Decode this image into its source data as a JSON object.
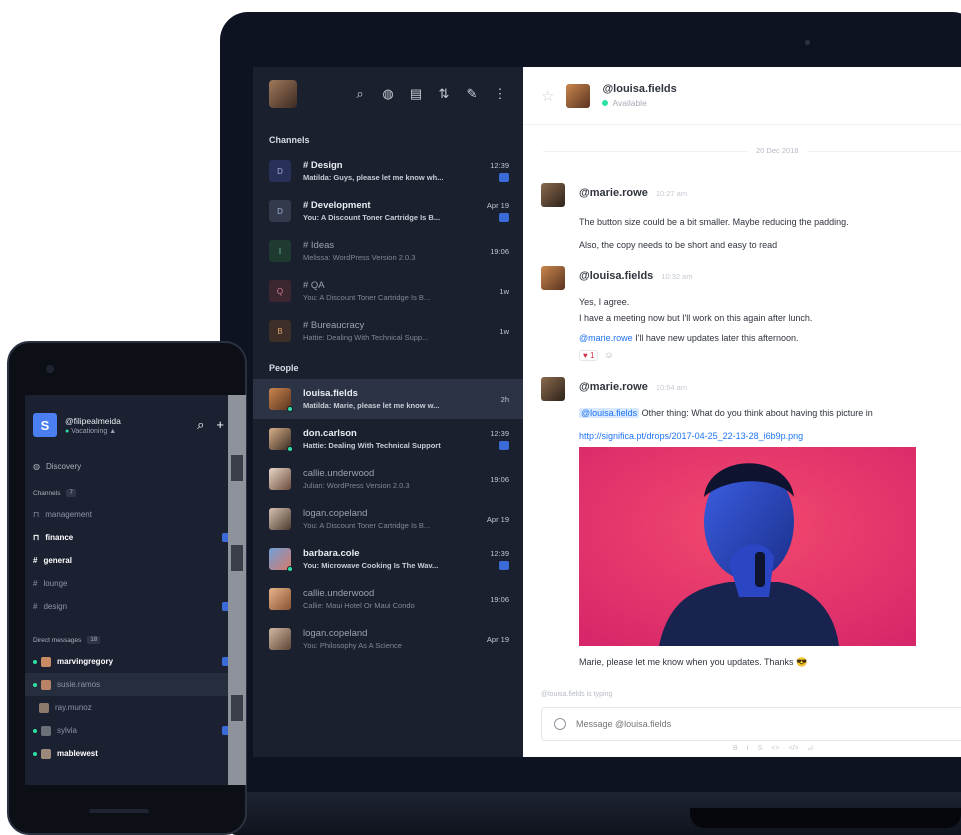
{
  "desktop": {
    "sidebar": {
      "channels_title": "Channels",
      "people_title": "People",
      "toolbar_icons": [
        "search-icon",
        "globe-icon",
        "directory-icon",
        "sort-icon",
        "edit-icon",
        "more-icon"
      ],
      "channels": [
        {
          "avatar": "D",
          "name": "# Design",
          "message": "Matilda: Guys, please let me know wh...",
          "time": "12:39",
          "unread": true,
          "bold": true
        },
        {
          "avatar": "D",
          "name": "# Development",
          "message": "You: A Discount Toner Cartridge Is B...",
          "time": "Apr 19",
          "unread": true,
          "bold": true
        },
        {
          "avatar": "I",
          "name": "# Ideas",
          "message": "Melissa: WordPress Version 2.0.3",
          "time": "19:06",
          "unread": false,
          "bold": false
        },
        {
          "avatar": "Q",
          "name": "# QA",
          "message": "You: A Discount Toner Cartridge Is B...",
          "time": "1w",
          "unread": false,
          "bold": false
        },
        {
          "avatar": "B",
          "name": "# Bureaucracy",
          "message": "Hattie: Dealing With Technical Supp...",
          "time": "1w",
          "unread": false,
          "bold": false
        }
      ],
      "people": [
        {
          "name": "louisa.fields",
          "message": "Matilda: Marie, please let me know w...",
          "time": "2h",
          "unread": false,
          "bold": true,
          "active": true
        },
        {
          "name": "don.carlson",
          "message": "Hattie: Dealing With Technical Support",
          "time": "12:39",
          "unread": true,
          "bold": true,
          "active": false
        },
        {
          "name": "callie.underwood",
          "message": "Julian: WordPress Version 2.0.3",
          "time": "19:06",
          "unread": false,
          "bold": false,
          "active": false
        },
        {
          "name": "logan.copeland",
          "message": "You: A Discount Toner Cartridge Is B...",
          "time": "Apr 19",
          "unread": false,
          "bold": false,
          "active": false
        },
        {
          "name": "barbara.cole",
          "message": "You: Microwave Cooking Is The Wav...",
          "time": "12:39",
          "unread": true,
          "bold": true,
          "active": false
        },
        {
          "name": "callie.underwood",
          "message": "Callie: Maui Hotel Or Maui Condo",
          "time": "19:06",
          "unread": false,
          "bold": false,
          "active": false
        },
        {
          "name": "logan.copeland",
          "message": "You: Philosophy As A Science",
          "time": "Apr 19",
          "unread": false,
          "bold": false,
          "active": false
        }
      ]
    },
    "chat": {
      "header_name": "@louisa.fields",
      "header_status": "Available",
      "date_separator": "20 Dec 2018",
      "messages": [
        {
          "user": "@marie.rowe",
          "time": "10:27 am",
          "lines": [
            "The button size could be a bit smaller. Maybe reducing the padding.",
            "Also, the copy needs to be short and easy to read"
          ]
        },
        {
          "user": "@louisa.fields",
          "time": "10:32 am",
          "lines": [
            "Yes, I agree.",
            "I have a meeting now but I'll work on this again after lunch."
          ],
          "mention": "@marie.rowe",
          "mention_rest": " I'll have new updates later this afternoon.",
          "reaction": "♥ 1"
        },
        {
          "user": "@marie.rowe",
          "time": "10:54 am",
          "mention": "@louisa.fields",
          "mention_rest": " Other thing: What do you think about having this picture in",
          "link": "http://significa.pt/drops/2017-04-25_22-13-28_i6b9p.png",
          "caption": "Marie, please let me know when you updates. Thanks 😎"
        }
      ],
      "typing_indicator": "@louisa.fields is typing",
      "composer_placeholder": "Message @louisa.fields",
      "format_icons": [
        "B",
        "I",
        "S",
        "<>",
        "</>",
        "⏎"
      ]
    }
  },
  "mobile": {
    "username": "@filipealmeida",
    "status": "Vacationing",
    "discovery_label": "Discovery",
    "channels_label": "Channels",
    "channels_count": "7",
    "channels": [
      {
        "name": "management",
        "icon": "🔒",
        "bold": false,
        "badge": false
      },
      {
        "name": "finance",
        "icon": "🔒",
        "bold": true,
        "badge": true
      },
      {
        "name": "general",
        "icon": "#",
        "bold": true,
        "badge": false
      },
      {
        "name": "lounge",
        "icon": "#",
        "bold": false,
        "badge": false
      },
      {
        "name": "design",
        "icon": "#",
        "bold": false,
        "badge": true
      }
    ],
    "dm_label": "Direct messages",
    "dm_count": "18",
    "direct_messages": [
      {
        "name": "marvingregory",
        "bold": true,
        "badge": true,
        "online": true,
        "active": false
      },
      {
        "name": "susie.ramos",
        "bold": false,
        "badge": false,
        "online": true,
        "active": true
      },
      {
        "name": "ray.munoz",
        "bold": false,
        "badge": false,
        "online": false,
        "active": false
      },
      {
        "name": "sylvia",
        "bold": false,
        "badge": true,
        "online": true,
        "active": false
      },
      {
        "name": "mablewest",
        "bold": true,
        "badge": false,
        "online": true,
        "active": false
      }
    ]
  }
}
